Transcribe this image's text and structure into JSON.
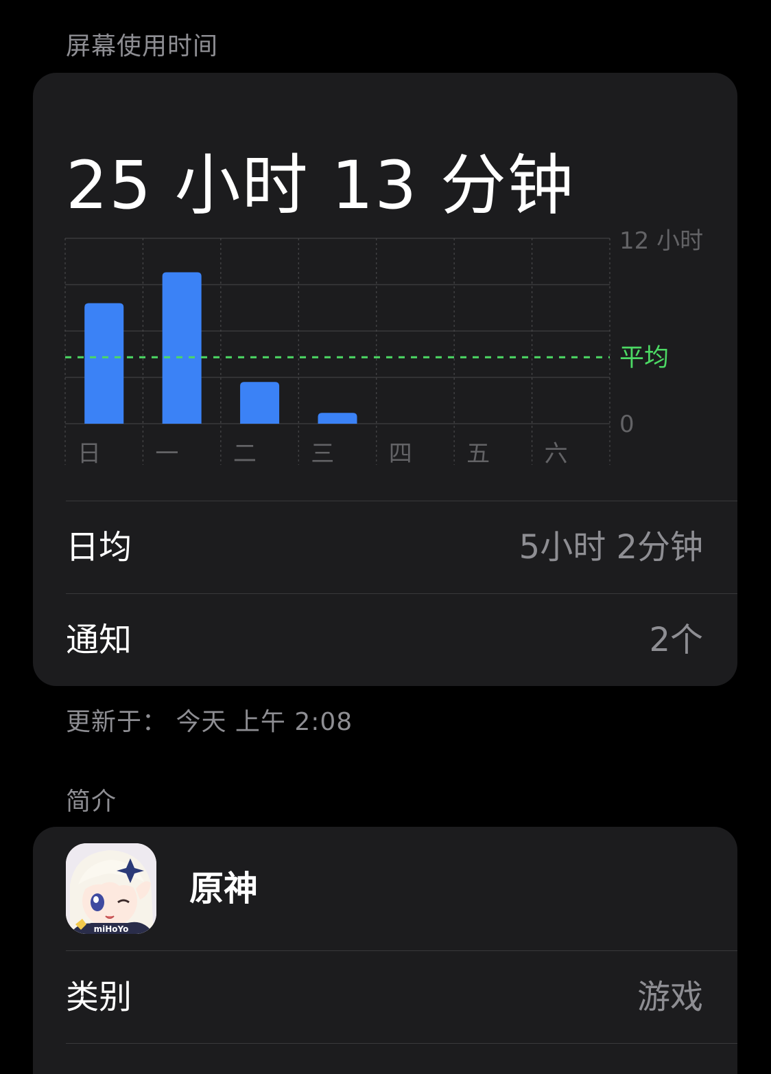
{
  "section_screen_time": "屏幕使用时间",
  "total": "25 小时 13 分钟",
  "chart_data": {
    "type": "bar",
    "categories": [
      "日",
      "一",
      "二",
      "三",
      "四",
      "五",
      "六"
    ],
    "values": [
      7.8,
      9.8,
      2.7,
      0.7,
      0,
      0,
      0
    ],
    "ylim": [
      0,
      12
    ],
    "y_top_label": "12 小时",
    "y_zero_label": "0",
    "average_label": "平均",
    "average_value": 4.3,
    "grid": true,
    "bar_color": "#3b82f6",
    "average_color": "#4cd964"
  },
  "stats": {
    "daily_avg_label": "日均",
    "daily_avg_value": "5小时 2分钟",
    "notifications_label": "通知",
    "notifications_value": "2个"
  },
  "updated": "更新于： 今天 上午 2:08",
  "section_profile": "简介",
  "profile": {
    "app_icon": "genshin-app-icon",
    "app_icon_text": "miHoYo",
    "app_name": "原神",
    "category_label": "类别",
    "category_value": "游戏"
  }
}
